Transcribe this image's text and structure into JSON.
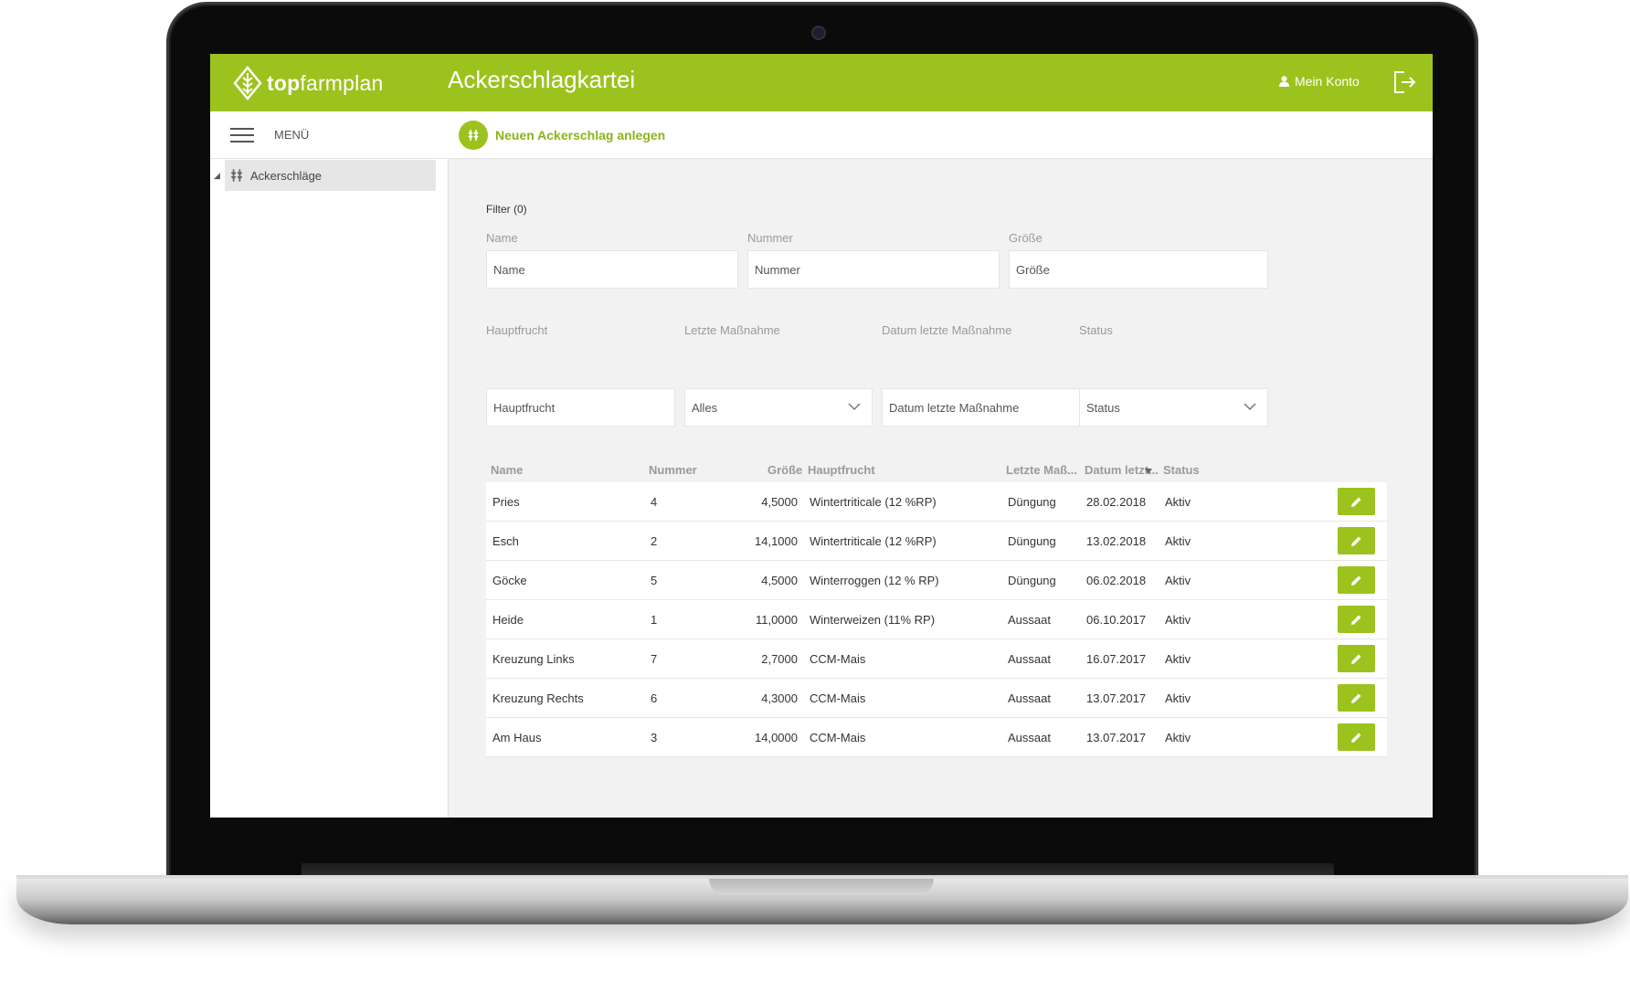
{
  "colors": {
    "brand": "#9cc21e",
    "brand_text": "#8cb31a"
  },
  "header": {
    "logo_bold": "top",
    "logo_light": "farmplan",
    "title": "Ackerschlagkartei",
    "account_label": "Mein Konto",
    "icons": [
      "user-icon",
      "logout-icon"
    ]
  },
  "subbar": {
    "menu_label": "MENÜ",
    "new_label": "Neuen Ackerschlag anlegen"
  },
  "sidebar": {
    "items": [
      {
        "label": "Ackerschläge",
        "expanded": true
      }
    ]
  },
  "filter": {
    "title": "Filter (0)",
    "name_label": "Name",
    "name_placeholder": "Name",
    "nummer_label": "Nummer",
    "nummer_placeholder": "Nummer",
    "groesse_label": "Größe",
    "groesse_placeholder": "Größe",
    "hauptfrucht_label": "Hauptfrucht",
    "hauptfrucht_placeholder": "Hauptfrucht",
    "massnahme_label": "Letzte Maßnahme",
    "massnahme_value": "Alles",
    "datum_label": "Datum letzte Maßnahme",
    "datum_placeholder": "Datum letzte Maßnahme",
    "status_label": "Status",
    "status_value": "Status"
  },
  "table": {
    "columns": [
      "Name",
      "Nummer",
      "Größe",
      "Hauptfrucht",
      "Letzte Maß...",
      "Datum letzt...",
      "Status"
    ],
    "rows": [
      {
        "name": "Pries",
        "nummer": "4",
        "groesse": "4,5000",
        "hauptfrucht": "Wintertriticale (12 %RP)",
        "massnahme": "Düngung",
        "datum": "28.02.2018",
        "status": "Aktiv"
      },
      {
        "name": "Esch",
        "nummer": "2",
        "groesse": "14,1000",
        "hauptfrucht": "Wintertriticale (12 %RP)",
        "massnahme": "Düngung",
        "datum": "13.02.2018",
        "status": "Aktiv"
      },
      {
        "name": "Göcke",
        "nummer": "5",
        "groesse": "4,5000",
        "hauptfrucht": "Winterroggen (12 % RP)",
        "massnahme": "Düngung",
        "datum": "06.02.2018",
        "status": "Aktiv"
      },
      {
        "name": "Heide",
        "nummer": "1",
        "groesse": "11,0000",
        "hauptfrucht": "Winterweizen (11% RP)",
        "massnahme": "Aussaat",
        "datum": "06.10.2017",
        "status": "Aktiv"
      },
      {
        "name": "Kreuzung Links",
        "nummer": "7",
        "groesse": "2,7000",
        "hauptfrucht": "CCM-Mais",
        "massnahme": "Aussaat",
        "datum": "16.07.2017",
        "status": "Aktiv"
      },
      {
        "name": "Kreuzung Rechts",
        "nummer": "6",
        "groesse": "4,3000",
        "hauptfrucht": "CCM-Mais",
        "massnahme": "Aussaat",
        "datum": "13.07.2017",
        "status": "Aktiv"
      },
      {
        "name": "Am Haus",
        "nummer": "3",
        "groesse": "14,0000",
        "hauptfrucht": "CCM-Mais",
        "massnahme": "Aussaat",
        "datum": "13.07.2017",
        "status": "Aktiv"
      }
    ]
  }
}
